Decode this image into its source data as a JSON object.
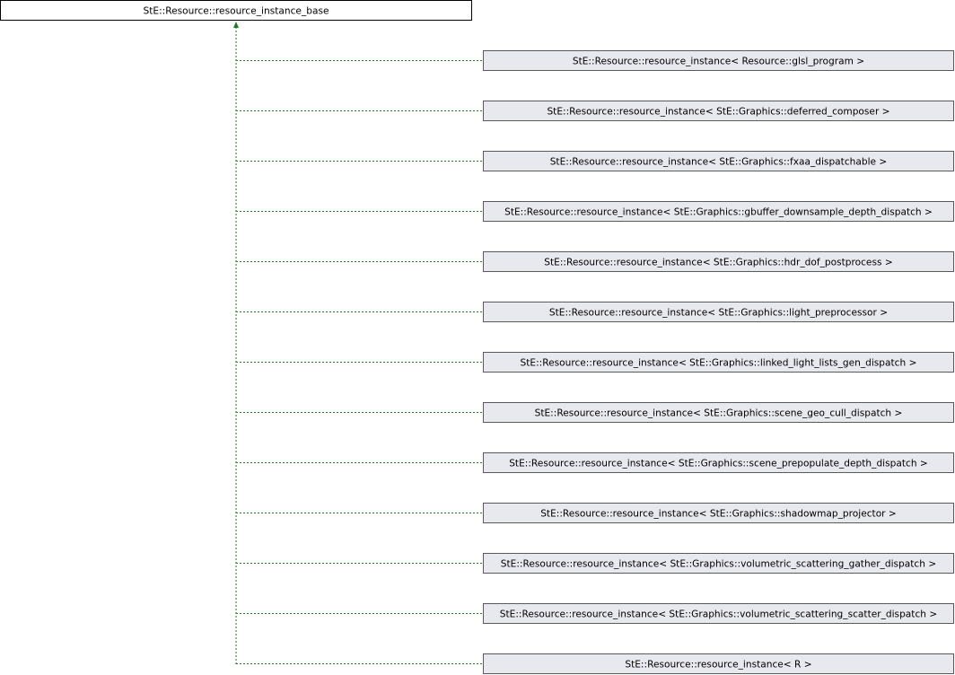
{
  "diagram": {
    "base_class": "StE::Resource::resource_instance_base",
    "derived_classes": [
      "StE::Resource::resource_instance< Resource::glsl_program >",
      "StE::Resource::resource_instance< StE::Graphics::deferred_composer >",
      "StE::Resource::resource_instance< StE::Graphics::fxaa_dispatchable >",
      "StE::Resource::resource_instance< StE::Graphics::gbuffer_downsample_depth_dispatch >",
      "StE::Resource::resource_instance< StE::Graphics::hdr_dof_postprocess >",
      "StE::Resource::resource_instance< StE::Graphics::light_preprocessor >",
      "StE::Resource::resource_instance< StE::Graphics::linked_light_lists_gen_dispatch >",
      "StE::Resource::resource_instance< StE::Graphics::scene_geo_cull_dispatch >",
      "StE::Resource::resource_instance< StE::Graphics::scene_prepopulate_depth_dispatch >",
      "StE::Resource::resource_instance< StE::Graphics::shadowmap_projector >",
      "StE::Resource::resource_instance< StE::Graphics::volumetric_scattering_gather_dispatch >",
      "StE::Resource::resource_instance< StE::Graphics::volumetric_scattering_scatter_dispatch >",
      "StE::Resource::resource_instance< R >"
    ],
    "colors": {
      "node_fill": "#e8e8ef",
      "node_border": "#5a5a5a",
      "base_border": "#000000",
      "edge": "#1e7a1e"
    }
  }
}
